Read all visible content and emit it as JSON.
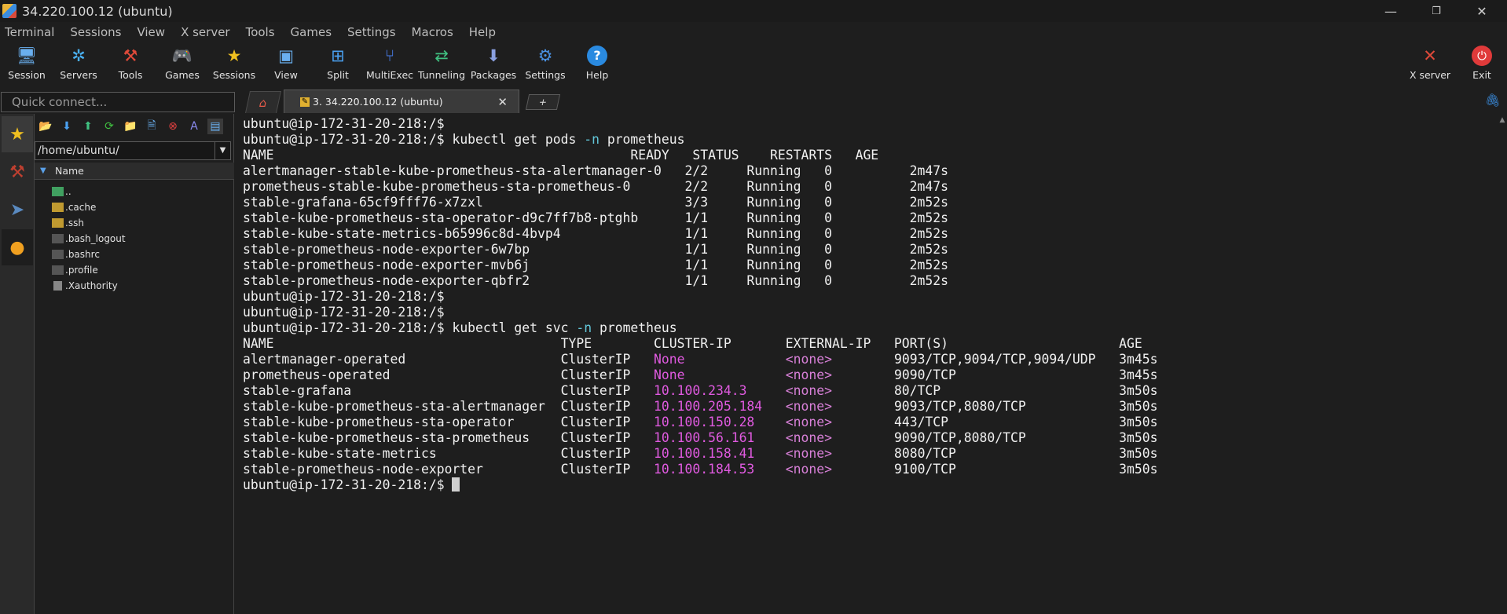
{
  "window": {
    "title": "34.220.100.12 (ubuntu)",
    "controls": [
      "—",
      "❐",
      "✕"
    ]
  },
  "menu": [
    "Terminal",
    "Sessions",
    "View",
    "X server",
    "Tools",
    "Games",
    "Settings",
    "Macros",
    "Help"
  ],
  "toolbar": {
    "session": "Session",
    "servers": "Servers",
    "tools": "Tools",
    "games": "Games",
    "sessions": "Sessions",
    "view": "View",
    "split": "Split",
    "multiexec": "MultiExec",
    "tunneling": "Tunneling",
    "packages": "Packages",
    "settings": "Settings",
    "help": "Help",
    "xserver": "X server",
    "exit": "Exit"
  },
  "quick_connect": {
    "placeholder": "Quick connect..."
  },
  "tabs": {
    "active_label": "3. 34.220.100.12 (ubuntu)",
    "close": "✕",
    "new": "+"
  },
  "sidebar": {
    "path": "/home/ubuntu/",
    "column": "Name",
    "files": [
      "..",
      ".cache",
      ".ssh",
      ".bash_logout",
      ".bashrc",
      ".profile",
      ".Xauthority"
    ]
  },
  "terminal": {
    "prompt": "ubuntu@ip-172-31-20-218:/$",
    "cmd1": {
      "pre": " kubectl get pods ",
      "opt": "-n",
      "post": " prometheus"
    },
    "pods_header": "NAME                                              READY   STATUS    RESTARTS   AGE",
    "pods": [
      "alertmanager-stable-kube-prometheus-sta-alertmanager-0   2/2     Running   0          2m47s",
      "prometheus-stable-kube-prometheus-sta-prometheus-0       2/2     Running   0          2m47s",
      "stable-grafana-65cf9fff76-x7zxl                          3/3     Running   0          2m52s",
      "stable-kube-prometheus-sta-operator-d9c7ff7b8-ptghb      1/1     Running   0          2m52s",
      "stable-kube-state-metrics-b65996c8d-4bvp4                1/1     Running   0          2m52s",
      "stable-prometheus-node-exporter-6w7bp                    1/1     Running   0          2m52s",
      "stable-prometheus-node-exporter-mvb6j                    1/1     Running   0          2m52s",
      "stable-prometheus-node-exporter-qbfr2                    1/1     Running   0          2m52s"
    ],
    "cmd2": {
      "pre": " kubectl get svc ",
      "opt": "-n",
      "post": " prometheus"
    },
    "svc_header": "NAME                                     TYPE        CLUSTER-IP       EXTERNAL-IP   PORT(S)                      AGE",
    "svc": [
      {
        "a": "alertmanager-operated                    ClusterIP   ",
        "ip": "None",
        "b": "             ",
        "ext": "<none>",
        "c": "        9093/TCP,9094/TCP,9094/UDP   3m45s"
      },
      {
        "a": "prometheus-operated                      ClusterIP   ",
        "ip": "None",
        "b": "             ",
        "ext": "<none>",
        "c": "        9090/TCP                     3m45s"
      },
      {
        "a": "stable-grafana                           ClusterIP   ",
        "ip": "10.100.234.3",
        "b": "     ",
        "ext": "<none>",
        "c": "        80/TCP                       3m50s"
      },
      {
        "a": "stable-kube-prometheus-sta-alertmanager  ClusterIP   ",
        "ip": "10.100.205.184",
        "b": "   ",
        "ext": "<none>",
        "c": "        9093/TCP,8080/TCP            3m50s"
      },
      {
        "a": "stable-kube-prometheus-sta-operator      ClusterIP   ",
        "ip": "10.100.150.28",
        "b": "    ",
        "ext": "<none>",
        "c": "        443/TCP                      3m50s"
      },
      {
        "a": "stable-kube-prometheus-sta-prometheus    ClusterIP   ",
        "ip": "10.100.56.161",
        "b": "    ",
        "ext": "<none>",
        "c": "        9090/TCP,8080/TCP            3m50s"
      },
      {
        "a": "stable-kube-state-metrics                ClusterIP   ",
        "ip": "10.100.158.41",
        "b": "    ",
        "ext": "<none>",
        "c": "        8080/TCP                     3m50s"
      },
      {
        "a": "stable-prometheus-node-exporter          ClusterIP   ",
        "ip": "10.100.184.53",
        "b": "    ",
        "ext": "<none>",
        "c": "        9100/TCP                     3m50s"
      }
    ]
  },
  "colors": {
    "option": "#62c6d8",
    "ip": "#e05ae0",
    "accent": "#3a8de0"
  }
}
